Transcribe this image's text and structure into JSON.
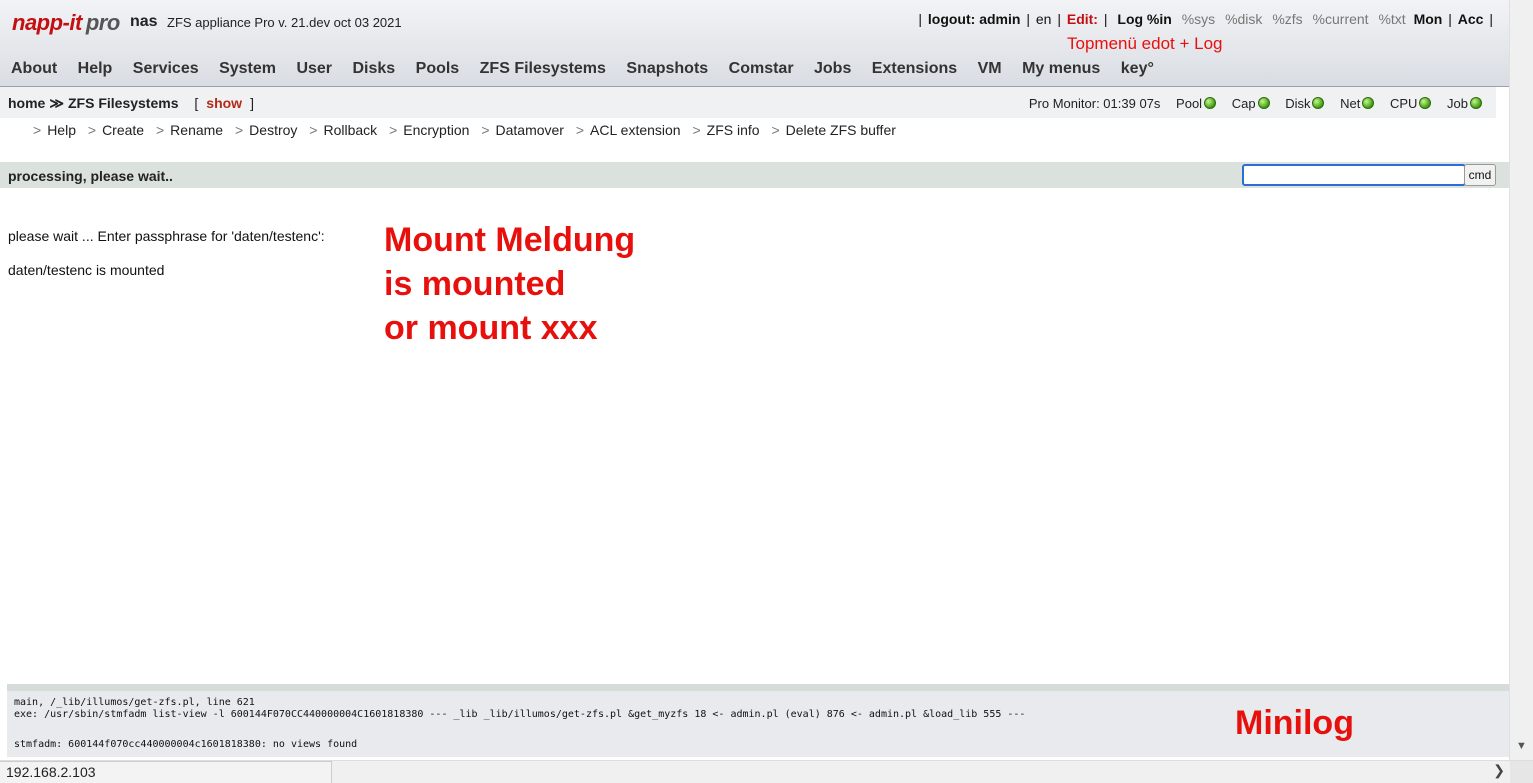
{
  "header": {
    "logo_text": "napp-it",
    "logo_pro": "pro",
    "host": "nas",
    "version": "ZFS appliance Pro v. 21.dev oct 03 2021",
    "topmenu": {
      "sep": "|",
      "logout": "logout: admin",
      "lang": "en",
      "edit": "Edit:",
      "log": "Log %in",
      "sys": "%sys",
      "disk": "%disk",
      "zfs": "%zfs",
      "current": "%current",
      "txt": "%txt",
      "mon": "Mon",
      "acc": "Acc"
    },
    "annotation": "Topmenü edot + Log"
  },
  "mainnav": [
    "About",
    "Help",
    "Services",
    "System",
    "User",
    "Disks",
    "Pools",
    "ZFS Filesystems",
    "Snapshots",
    "Comstar",
    "Jobs",
    "Extensions",
    "VM",
    "My menus",
    "key°"
  ],
  "breadcrumb": {
    "home": "home",
    "arrows": "≫",
    "current": "ZFS Filesystems",
    "open_bracket": "[",
    "show": "show",
    "close_bracket": "]"
  },
  "monitor": {
    "label": "Pro Monitor: 01:39 07s",
    "items": [
      "Pool",
      "Cap",
      "Disk",
      "Net",
      "CPU",
      "Job"
    ],
    "status_color": "#3e9a12"
  },
  "submenu": [
    "Help",
    "Create",
    "Rename",
    "Destroy",
    "Rollback",
    "Encryption",
    "Datamover",
    "ACL extension",
    "ZFS info",
    "Delete ZFS buffer"
  ],
  "submenu_arrow": ">",
  "status": {
    "text": "processing, please wait..",
    "cmd_value": "",
    "cmd_button": "cmd"
  },
  "output": {
    "line1": "please wait ... Enter passphrase for 'daten/testenc':",
    "line2": "daten/testenc is mounted"
  },
  "annotation_main": [
    "Mount Meldung",
    "is mounted",
    "or mount xxx"
  ],
  "minilog": {
    "line1": "main, /_lib/illumos/get-zfs.pl, line 621",
    "line2": "exe: /usr/sbin/stmfadm list-view -l 600144F070CC440000004C1601818380 --- _lib _lib/illumos/get-zfs.pl &get_myzfs 18 <- admin.pl (eval) 876 <- admin.pl &load_lib 555 ---",
    "line3": "stmfadm: 600144f070cc440000004c1601818380: no views found",
    "annotation": "Minilog"
  },
  "browser_status_url": "192.168.2.103",
  "colors": {
    "annotation": "#e8100c",
    "brand": "#c40f12",
    "show_link": "#b42a18"
  }
}
